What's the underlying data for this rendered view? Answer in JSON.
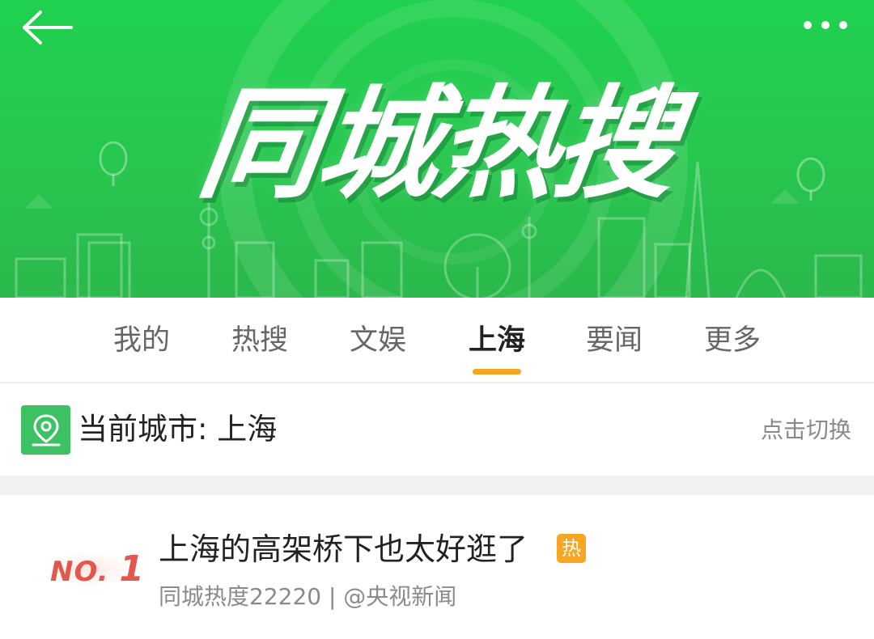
{
  "banner": {
    "title": "同城热搜",
    "back_icon": "arrow-left-icon",
    "more_icon": "more-dots-icon",
    "background_color": "#27c64e"
  },
  "tabs": [
    {
      "label": "我的",
      "active": false
    },
    {
      "label": "热搜",
      "active": false
    },
    {
      "label": "文娱",
      "active": false
    },
    {
      "label": "上海",
      "active": true
    },
    {
      "label": "要闻",
      "active": false
    },
    {
      "label": "更多",
      "active": false
    }
  ],
  "colors": {
    "accent": "#f5a623",
    "brand_green": "#3cc262",
    "rank_red": "#e4574c"
  },
  "city": {
    "label": "当前城市: 上海",
    "switch_label": "点击切换",
    "icon": "location-pin-icon"
  },
  "list": [
    {
      "rank_prefix": "NO.",
      "rank_number": "1",
      "title": "上海的高架桥下也太好逛了",
      "badge": "热",
      "meta": "同城热度22220 | @央视新闻"
    }
  ]
}
